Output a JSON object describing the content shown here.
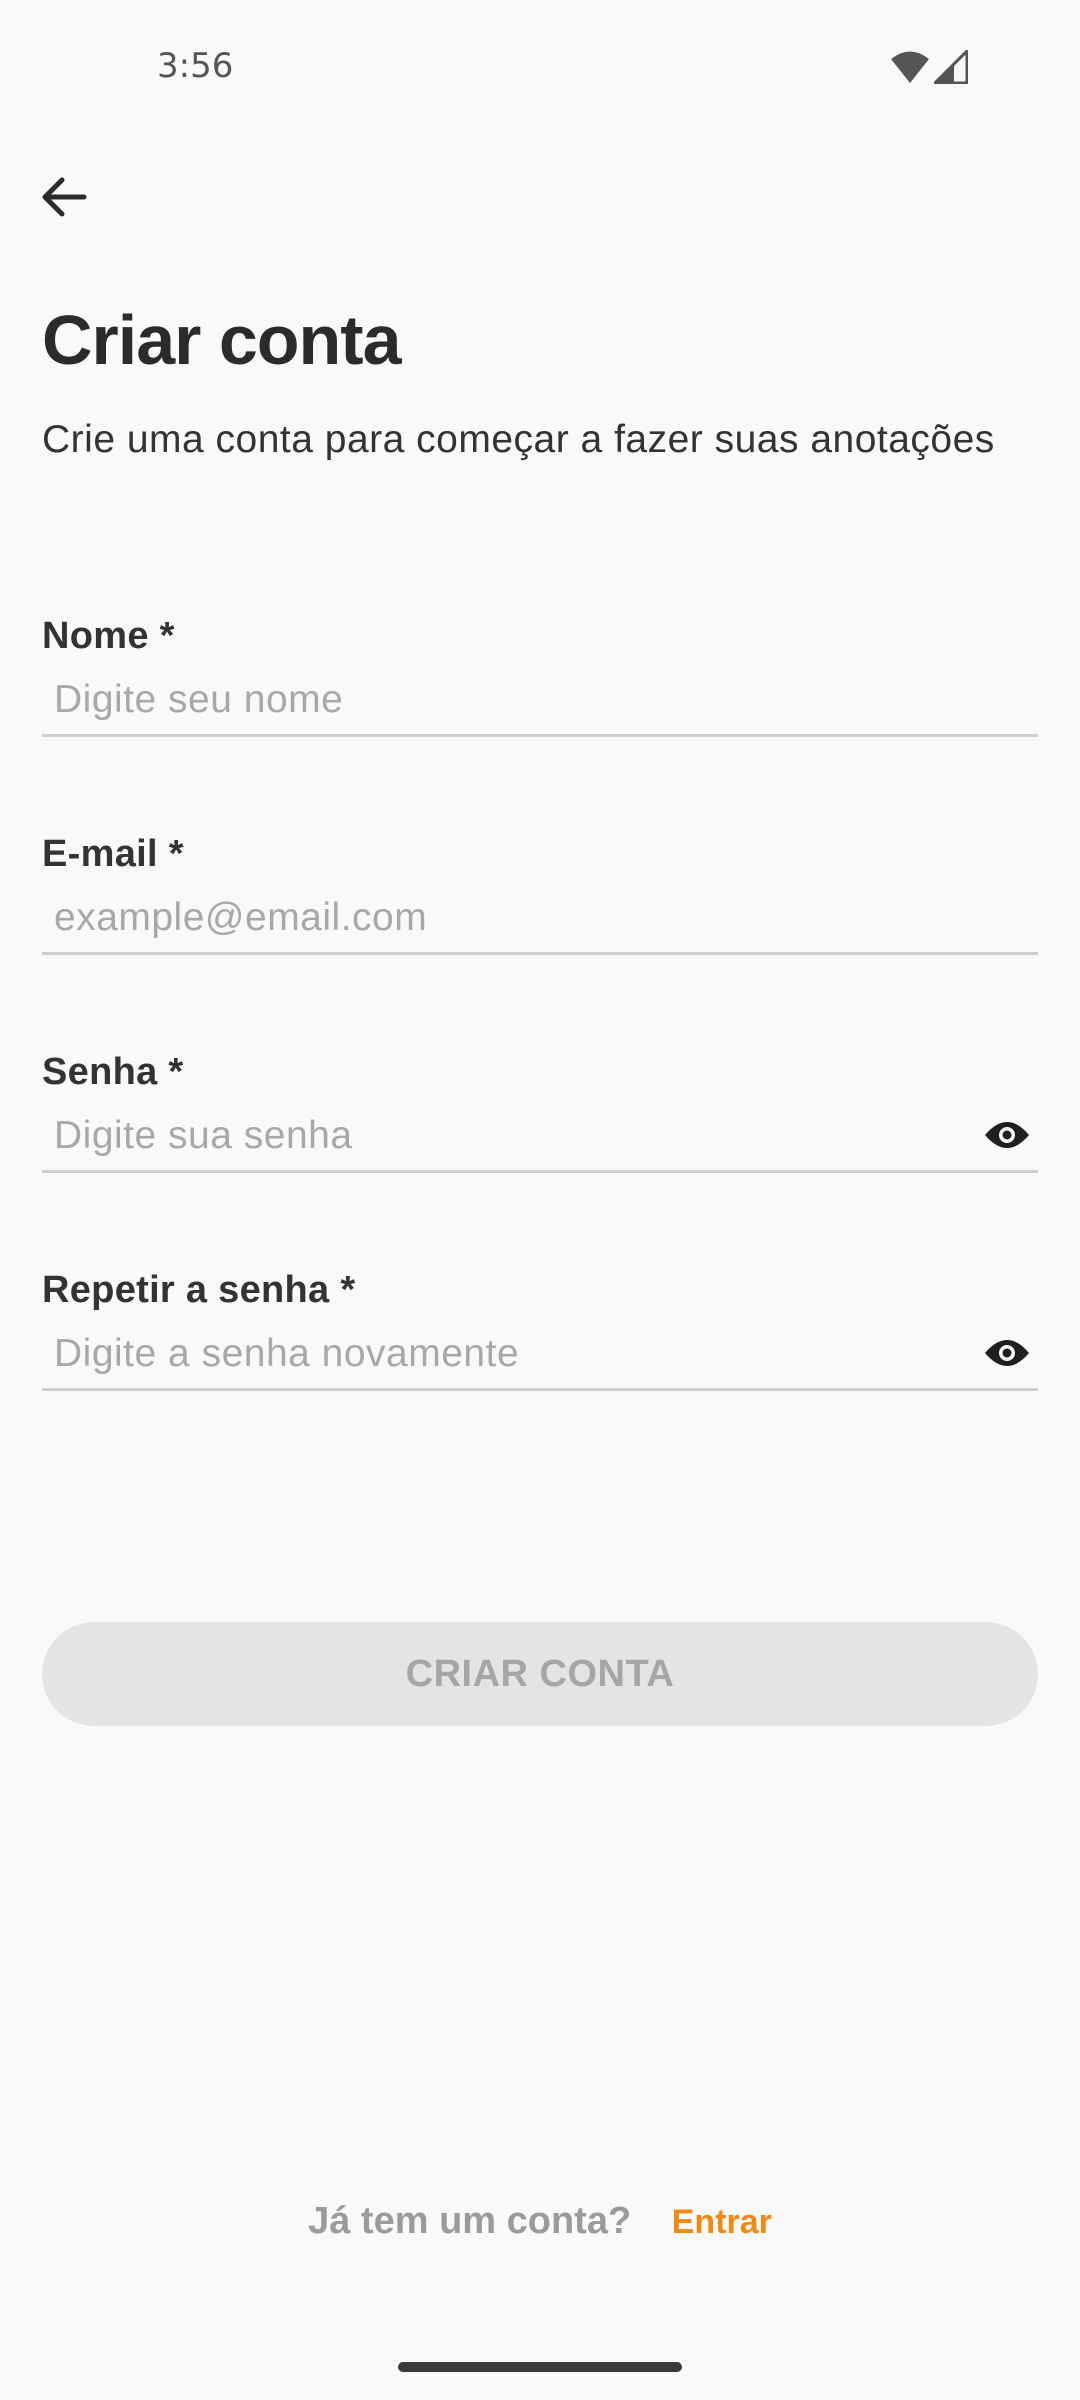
{
  "status_bar": {
    "time": "3:56",
    "icons": [
      "wifi-icon",
      "cellular-signal-icon"
    ]
  },
  "header": {
    "back_icon": "arrow-left-icon",
    "title": "Criar conta",
    "subtitle": "Crie uma conta para começar a fazer suas anotações"
  },
  "form": {
    "name": {
      "label": "Nome *",
      "value": "",
      "placeholder": "Digite seu nome"
    },
    "email": {
      "label": "E-mail *",
      "value": "",
      "placeholder": "example@email.com"
    },
    "password": {
      "label": "Senha *",
      "value": "",
      "placeholder": "Digite sua senha",
      "toggle_icon": "eye-icon"
    },
    "password_repeat": {
      "label": "Repetir a senha *",
      "value": "",
      "placeholder": "Digite a senha novamente",
      "toggle_icon": "eye-icon"
    },
    "submit_label": "CRIAR CONTA",
    "submit_enabled": false
  },
  "footer": {
    "prompt": "Já tem um conta?",
    "link_label": "Entrar"
  },
  "colors": {
    "background": "#f9f9f9",
    "accent": "#ef8a17",
    "button_disabled_bg": "#e3e4e6",
    "button_disabled_text": "#a4a6a8",
    "placeholder": "#a8a8a8",
    "underline": "#cfcfcf"
  }
}
